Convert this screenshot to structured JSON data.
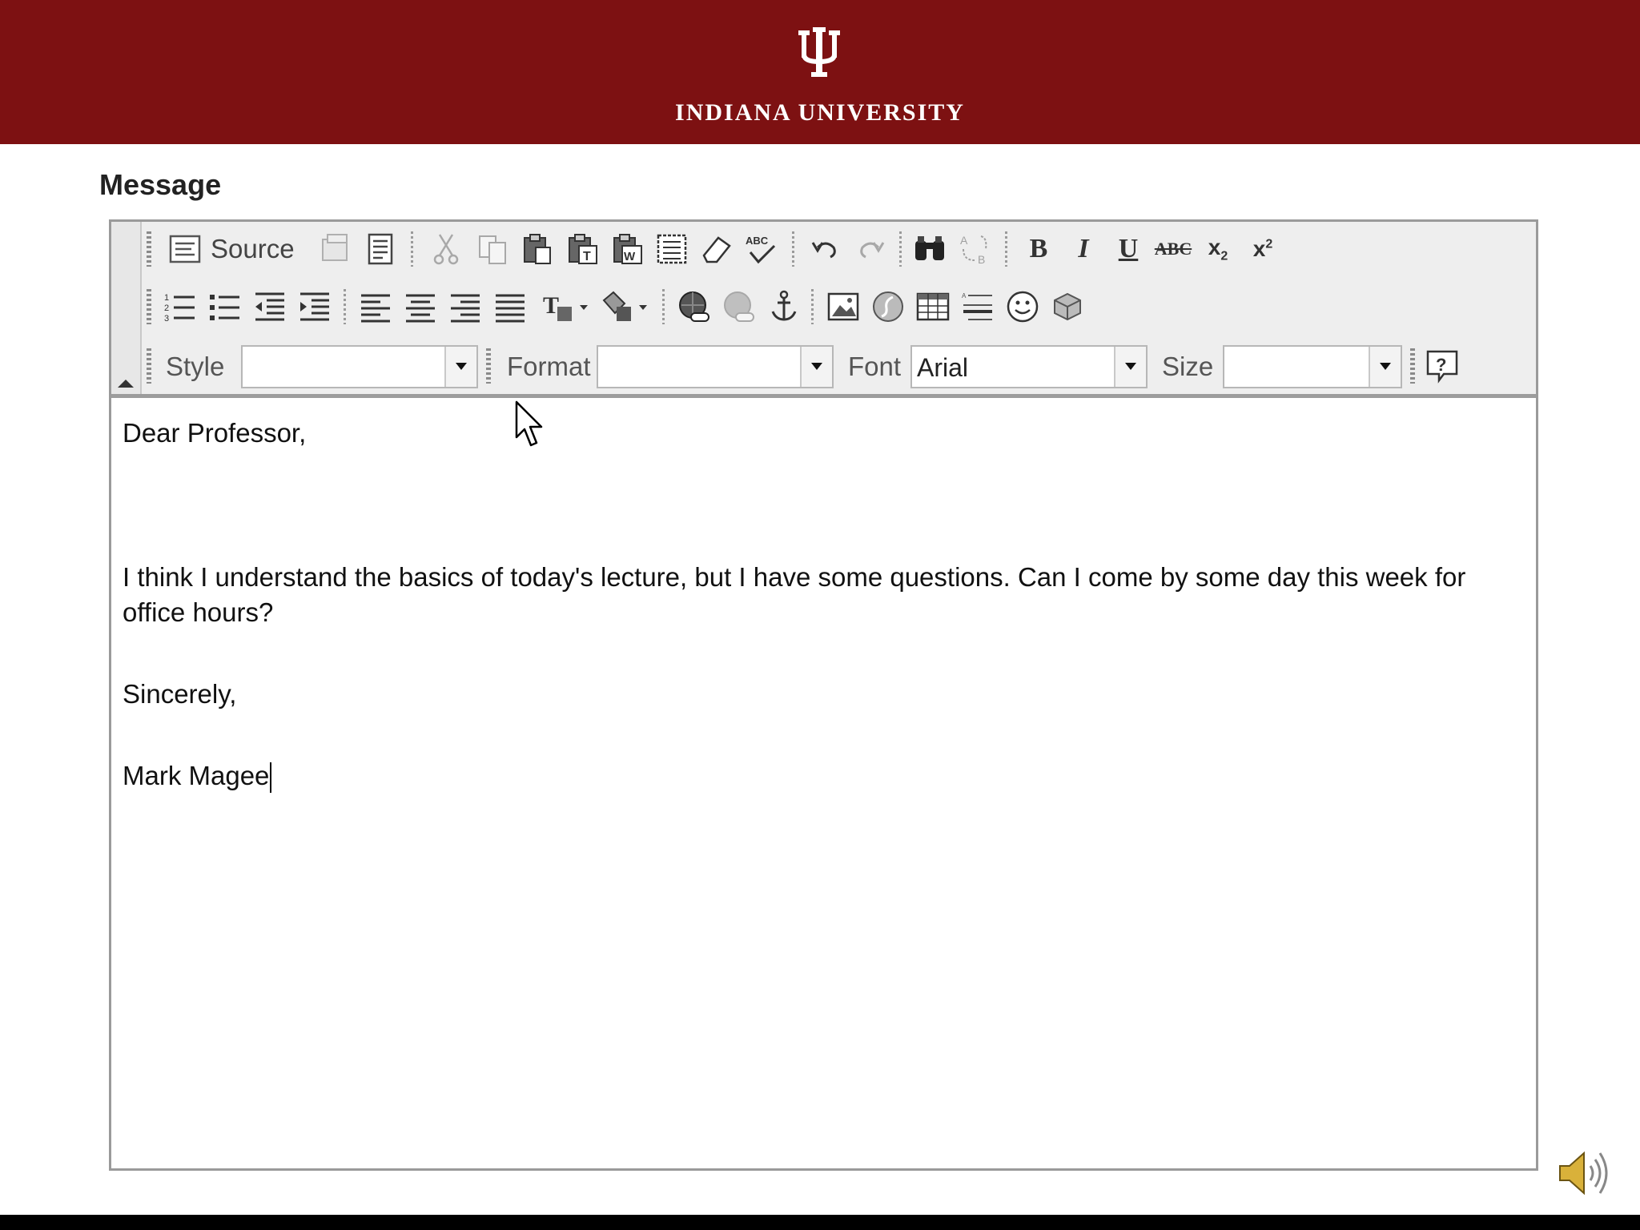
{
  "header": {
    "university_name": "INDIANA UNIVERSITY",
    "logo_icon": "iu-trident-logo",
    "brand_color": "#7d1112"
  },
  "form": {
    "message_label": "Message"
  },
  "toolbar": {
    "source_label": "Source",
    "style_label": "Style",
    "style_value": "",
    "format_label": "Format",
    "format_value": "",
    "font_label": "Font",
    "font_value": "Arial",
    "size_label": "Size",
    "size_value": "",
    "row1_icons": [
      "source-icon",
      "save-template-icon",
      "templates-icon",
      "cut-icon",
      "copy-icon",
      "paste-icon",
      "paste-text-icon",
      "paste-word-icon",
      "select-all-icon",
      "eraser-icon",
      "spellcheck-icon",
      "undo-icon",
      "redo-icon",
      "find-icon",
      "replace-icon",
      "bold-icon",
      "italic-icon",
      "underline-icon",
      "strikethrough-icon",
      "subscript-icon",
      "superscript-icon"
    ],
    "row2_icons": [
      "numbered-list-icon",
      "bulleted-list-icon",
      "outdent-icon",
      "indent-icon",
      "align-left-icon",
      "align-center-icon",
      "align-right-icon",
      "justify-icon",
      "text-color-icon",
      "background-color-icon",
      "link-icon",
      "unlink-icon",
      "anchor-icon",
      "image-icon",
      "flash-icon",
      "table-icon",
      "horizontal-rule-icon",
      "smiley-icon",
      "special-char-icon"
    ]
  },
  "editor": {
    "greeting": "Dear Professor,",
    "body": "I think I understand the basics of today's lecture, but I have some questions. Can I come by some day this week for office hours?",
    "closing": "Sincerely,",
    "signature": "Mark Magee"
  }
}
